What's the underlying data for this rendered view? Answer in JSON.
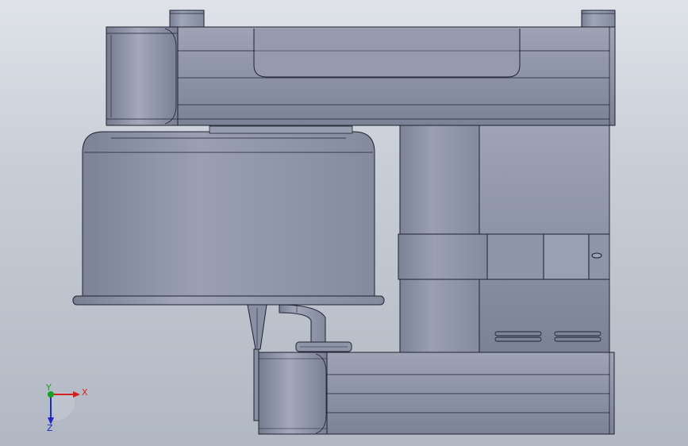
{
  "viewport": {
    "background_top": "#dfe3e9",
    "background_bottom": "#b1b8c3",
    "model_color": "#8c93a6",
    "edge_color": "#1e2230"
  },
  "triad": {
    "x_label": "X",
    "y_label": "Y",
    "z_label": "Z",
    "x_color": "#d42020",
    "y_color": "#14a020",
    "z_color": "#2028c8"
  }
}
